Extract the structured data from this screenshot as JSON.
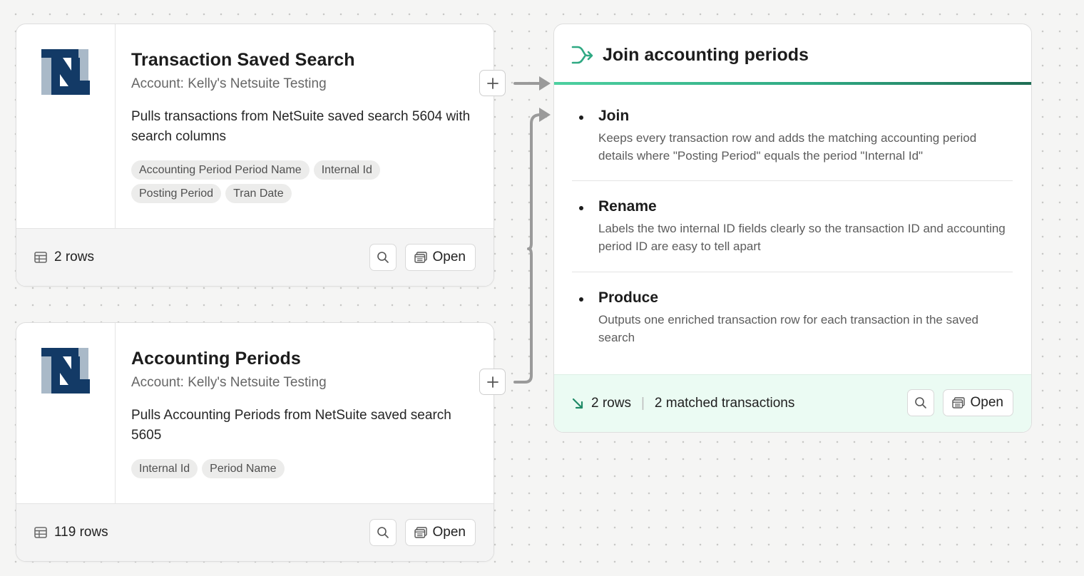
{
  "sources": [
    {
      "title": "Transaction Saved Search",
      "account": "Account: Kelly's Netsuite Testing",
      "description": "Pulls transactions from NetSuite saved search 5604 with search columns",
      "columns": [
        "Accounting Period Period Name",
        "Internal Id",
        "Posting Period",
        "Tran Date"
      ],
      "rows": "2 rows",
      "open_label": "Open",
      "logo_icon": "netsuite-logo"
    },
    {
      "title": "Accounting Periods",
      "account": "Account: Kelly's Netsuite Testing",
      "description": "Pulls Accounting Periods from NetSuite saved search 5605",
      "columns": [
        "Internal Id",
        "Period Name"
      ],
      "rows": "119 rows",
      "open_label": "Open",
      "logo_icon": "netsuite-logo"
    }
  ],
  "transform": {
    "title": "Join accounting periods",
    "icon": "merge-icon",
    "steps": [
      {
        "name": "Join",
        "description": "Keeps every transaction row and adds the matching accounting period details where \"Posting Period\" equals the period \"Internal Id\""
      },
      {
        "name": "Rename",
        "description": "Labels the two internal ID fields clearly so the transaction ID and accounting period ID are easy to tell apart"
      },
      {
        "name": "Produce",
        "description": "Outputs one enriched transaction row for each transaction in the saved search"
      }
    ],
    "rows": "2 rows",
    "matched": "2 matched transactions",
    "separator": "|",
    "open_label": "Open"
  },
  "colors": {
    "accent": "#2fa983",
    "accent_dark": "#1f6d54",
    "netsuite_dark": "#133a66",
    "netsuite_light": "#a9b9c8",
    "footer_green": "#ebfbf3"
  }
}
